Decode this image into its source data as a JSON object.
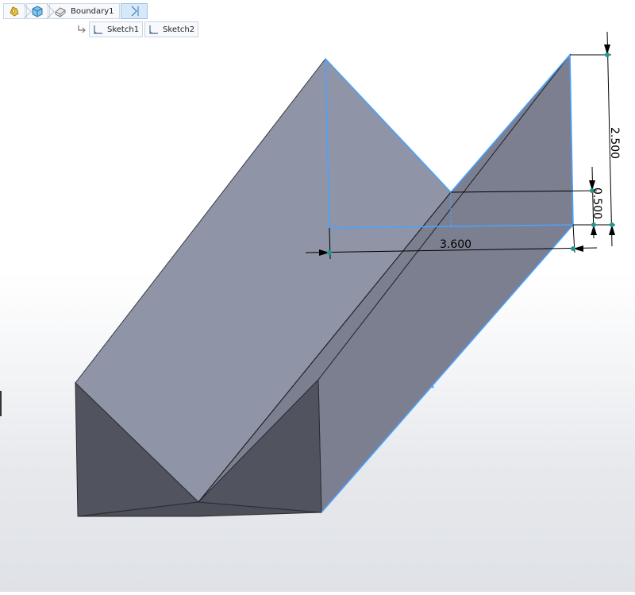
{
  "breadcrumb": {
    "items": [
      {
        "icon": "part-icon"
      },
      {
        "icon": "body-icon"
      },
      {
        "icon": "feature-icon",
        "label": "Boundary1"
      }
    ]
  },
  "sketches": {
    "items": [
      {
        "label": "Sketch1"
      },
      {
        "label": "Sketch2"
      }
    ]
  },
  "dimensions": {
    "height": "2.500",
    "offset": "0.500",
    "width": "3.600"
  },
  "colors": {
    "face_top": "#8f94a6",
    "face_side": "#7b7f90",
    "face_front": "#51545e",
    "highlight": "#4aa3ff",
    "dim_point": "#1f9a8e"
  }
}
